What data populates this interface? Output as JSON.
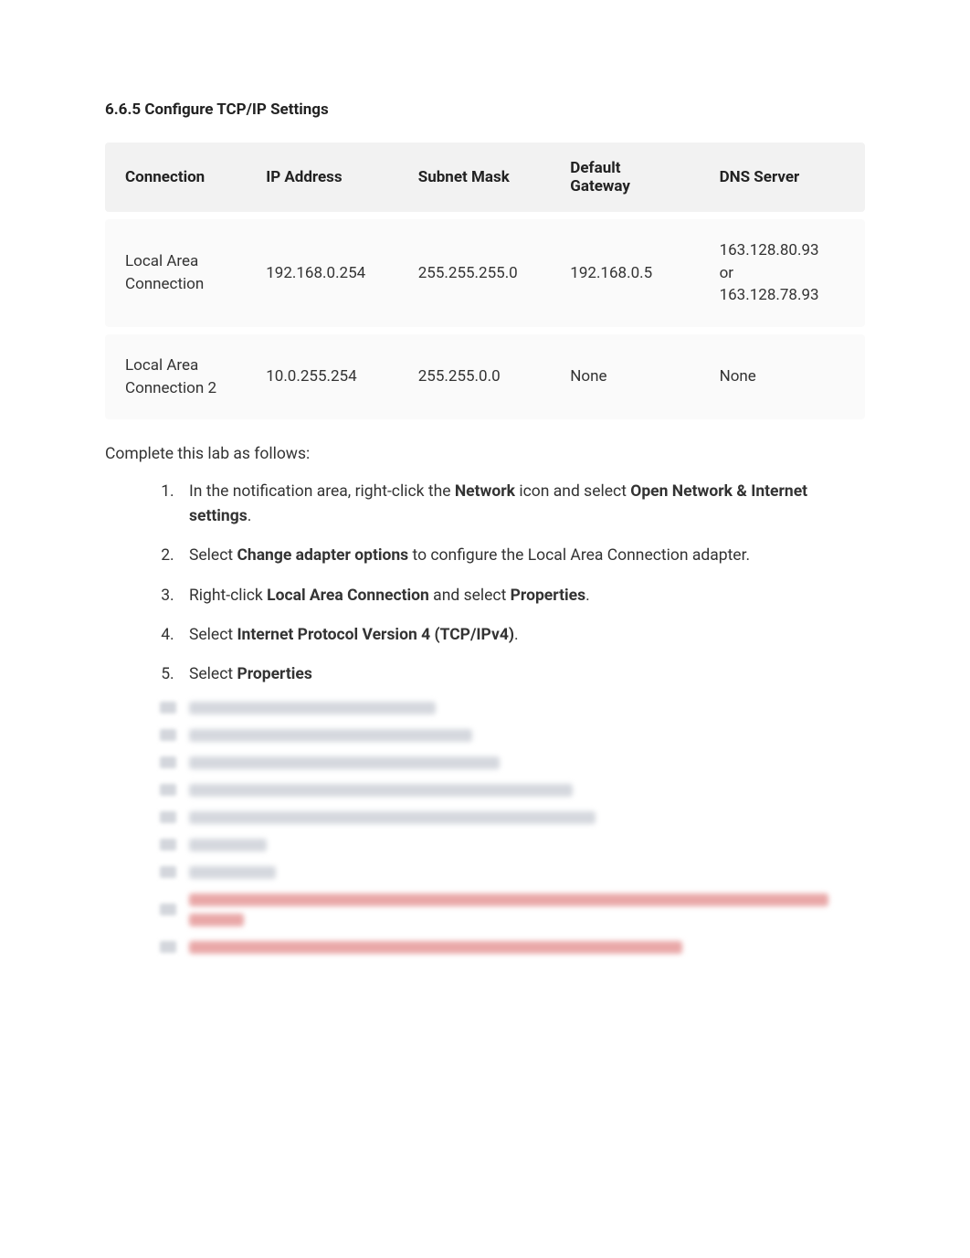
{
  "title": "6.6.5 Configure TCP/IP Settings",
  "table": {
    "headers": {
      "connection": "Connection",
      "ip_address": "IP Address",
      "subnet_mask": "Subnet Mask",
      "default_gateway": "Default Gateway",
      "dns_server": "DNS Server"
    },
    "rows": [
      {
        "connection": "Local Area Connection",
        "ip_address": "192.168.0.254",
        "subnet_mask": "255.255.255.0",
        "default_gateway": "192.168.0.5",
        "dns_server": "163.128.80.93\nor\n163.128.78.93"
      },
      {
        "connection": "Local Area Connection 2",
        "ip_address": "10.0.255.254",
        "subnet_mask": "255.255.0.0",
        "default_gateway": "None",
        "dns_server": "None"
      }
    ]
  },
  "intro": "Complete this lab as follows:",
  "steps": [
    {
      "parts": [
        {
          "t": "In the notification area, right-click the "
        },
        {
          "t": "Network",
          "b": true
        },
        {
          "t": " icon and select "
        },
        {
          "t": "Open Network & Internet settings",
          "b": true
        },
        {
          "t": "."
        }
      ]
    },
    {
      "parts": [
        {
          "t": "Select "
        },
        {
          "t": "Change adapter options",
          "b": true
        },
        {
          "t": " to configure the Local Area Connection adapter."
        }
      ]
    },
    {
      "parts": [
        {
          "t": "Right-click "
        },
        {
          "t": "Local Area Connection",
          "b": true
        },
        {
          "t": " and select "
        },
        {
          "t": "Properties",
          "b": true
        },
        {
          "t": "."
        }
      ]
    },
    {
      "parts": [
        {
          "t": "Select "
        },
        {
          "t": "Internet Protocol Version 4 (TCP/IPv4)",
          "b": true
        },
        {
          "t": "."
        }
      ]
    },
    {
      "parts": [
        {
          "t": "Select "
        },
        {
          "t": "Properties",
          "b": true
        }
      ]
    }
  ],
  "blurred_widths": [
    [
      270
    ],
    [
      310
    ],
    [
      340
    ],
    [
      420
    ],
    [
      445
    ],
    [
      85
    ],
    [
      95
    ],
    [
      700,
      60
    ],
    [
      540
    ]
  ]
}
